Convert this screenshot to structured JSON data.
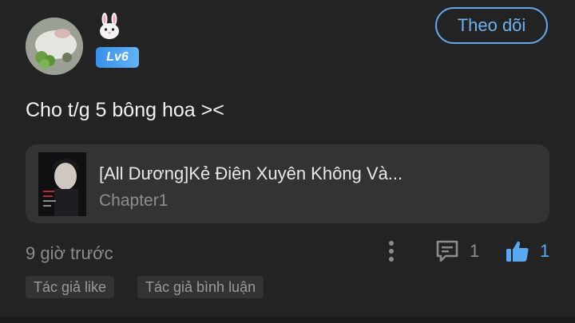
{
  "user": {
    "avatar_icon": "avatar-food-photo",
    "emoji_icon": "rabbit-face-icon",
    "level": "Lv6",
    "follow_label": "Theo dõi"
  },
  "comment": {
    "text": "Cho t/g 5 bông hoa ><"
  },
  "story": {
    "title": "[All Dương]Kẻ Điên Xuyên Không Và...",
    "chapter": "Chapter1",
    "cover_icon": "book-cover-thumbnail"
  },
  "meta": {
    "time_ago": "9 giờ trước",
    "comment_count": "1",
    "like_count": "1"
  },
  "tags": [
    "Tác giả like",
    "Tác giả bình luận"
  ],
  "colors": {
    "accent": "#5ea8ee",
    "background": "#232323",
    "card": "#333333"
  }
}
